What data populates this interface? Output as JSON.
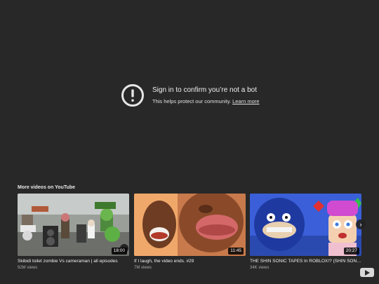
{
  "error": {
    "title": "Sign in to confirm you’re not a bot",
    "subtitle": "This helps protect our community.",
    "link": "Learn more"
  },
  "more_videos": {
    "heading": "More videos on YouTube",
    "items": [
      {
        "title": "Skibidi toilet zombie Vs cameraman | all episodes",
        "views": "92M views",
        "duration": "18:00"
      },
      {
        "title": "If I laugh, the video ends. #29",
        "views": "7M views",
        "duration": "11:45"
      },
      {
        "title": "THE SHIN SONIC TAPES In ROBLOX!? (SHIN SONIC...",
        "views": "34K views",
        "duration": "20:27"
      }
    ]
  },
  "icons": {
    "error": "alert-circle-icon",
    "next": "chevron-right-icon",
    "logo": "youtube-logo-icon"
  },
  "colors": {
    "background": "#282828",
    "text": "#f1f1f1",
    "subtext": "#aaaaaa"
  }
}
